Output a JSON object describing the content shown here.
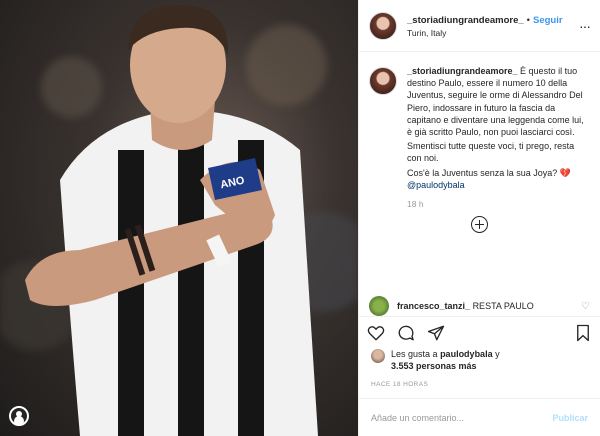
{
  "post": {
    "username": "_storiadiungrandeamore_",
    "follow_label": "Seguir",
    "separator": "•",
    "location": "Turin, Italy",
    "more_glyph": "···"
  },
  "caption": {
    "username": "_storiadiungrandeamore_",
    "lines": [
      "È questo il tuo destino Paulo, essere il numero 10 della Juventus, seguire le orme di Alessandro Del Piero, indossare in futuro la fascia da capitano e diventare una leggenda come lui, è già scritto Paulo, non puoi lasciarci così.",
      "Smentisci tutte queste voci, ti prego, resta con noi.",
      "Cos'è la Juventus senza la sua Joya?"
    ],
    "heart_glyph": "💔",
    "mention": "@paulodybala",
    "time": "18 h"
  },
  "comment": {
    "username": "francesco_tanzi_",
    "text": "RESTA PAULO"
  },
  "likes": {
    "prefix": "Les gusta a",
    "user": "paulodybala",
    "suffix": "y",
    "count": "3.553 personas más"
  },
  "timestamp": "HACE 18 HORAS",
  "add_comment": {
    "placeholder": "Añade un comentario...",
    "publish_label": "Publicar"
  },
  "colors": {
    "accent": "#3897f0",
    "publish_disabled": "#b2dffc",
    "mention": "#003569"
  }
}
